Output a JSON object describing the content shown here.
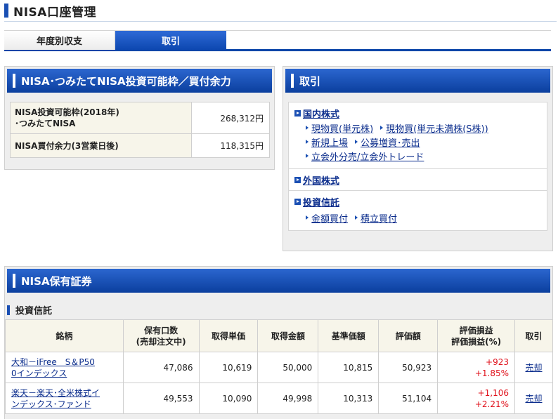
{
  "page": {
    "title": "NISA口座管理"
  },
  "tabs": [
    {
      "label": "年度別収支",
      "active": false
    },
    {
      "label": "取引",
      "active": true
    }
  ],
  "quota_panel": {
    "title": "NISA･つみたてNISA投資可能枠／買付余力",
    "rows": [
      {
        "label_line1": "NISA投資可能枠(2018年)",
        "label_line2": "･つみたてNISA",
        "value": "268,312円"
      },
      {
        "label_line1": "NISA買付余力(3営業日後)",
        "label_line2": "",
        "value": "118,315円"
      }
    ]
  },
  "trade_panel": {
    "title": "取引",
    "domestic": {
      "title": "国内株式",
      "links": [
        "現物買(単元株)",
        "現物買(単元未満株(S株))",
        "新規上場",
        "公募増資･売出",
        "立会外分売/立会外トレード"
      ]
    },
    "foreign": {
      "title": "外国株式"
    },
    "funds": {
      "title": "投資信託",
      "links": [
        "金額買付",
        "積立買付"
      ]
    }
  },
  "holdings": {
    "title": "NISA保有証券",
    "section": "投資信託",
    "headers": {
      "name": "銘柄",
      "units_1": "保有口数",
      "units_2": "(売却注文中)",
      "unit_cost": "取得単価",
      "cost": "取得金額",
      "nav": "基準価額",
      "value": "評価額",
      "pl_1": "評価損益",
      "pl_2": "評価損益(%)",
      "action": "取引"
    },
    "rows": [
      {
        "name_1": "大和－iFree　S＆P50",
        "name_2": "0インデックス",
        "units": "47,086",
        "unit_cost": "10,619",
        "cost": "50,000",
        "nav": "10,815",
        "value": "50,923",
        "pl": "+923",
        "pl_pct": "+1.85%",
        "action": "売却"
      },
      {
        "name_1": "楽天－楽天･全米株式イ",
        "name_2": "ンデックス･ファンド",
        "units": "49,553",
        "unit_cost": "10,090",
        "cost": "49,998",
        "nav": "10,313",
        "value": "51,104",
        "pl": "+1,106",
        "pl_pct": "+2.21%",
        "action": "売却"
      }
    ]
  },
  "colors": {
    "brand_blue": "#0d47b0",
    "profit_red": "#e0101a",
    "label_bg": "#f7f5ea"
  }
}
